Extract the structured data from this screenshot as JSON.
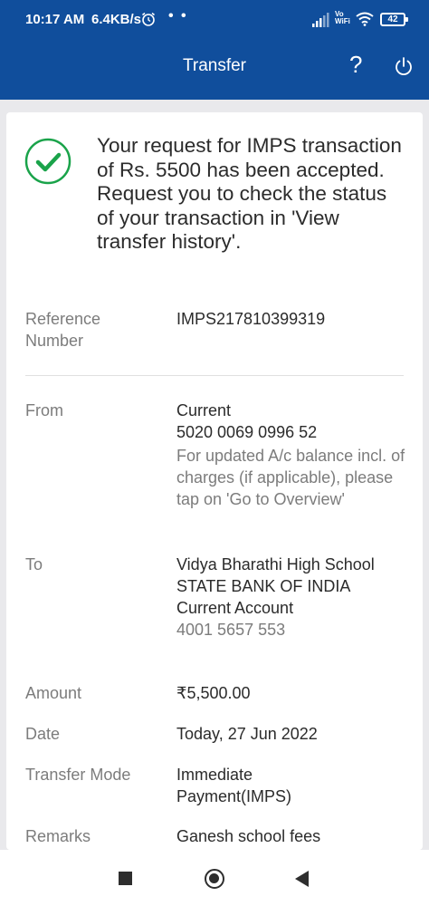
{
  "status_bar": {
    "time": "10:17 AM",
    "speed": "6.4KB/s",
    "dots": "• •",
    "vo_wifi_top": "Vo",
    "vo_wifi_bottom": "WiFi",
    "battery": "42"
  },
  "header": {
    "title": "Transfer",
    "help": "?",
    "color": "#104e9c"
  },
  "confirmation": {
    "message": "Your request for IMPS transaction of Rs. 5500 has been accepted. Request you to check the status of your transaction in 'View transfer history'.",
    "icon": "check-circle-icon",
    "icon_color": "#1aa34a"
  },
  "details": {
    "reference": {
      "label_1": "Reference",
      "label_2": "Number",
      "value": "IMPS217810399319"
    },
    "from": {
      "label": "From",
      "account_type": "Current",
      "account_number": "5020 0069 0996 52",
      "note": "For updated A/c balance incl. of charges (if applicable), please tap on 'Go to Overview'"
    },
    "to": {
      "label": "To",
      "name": "Vidya Bharathi High School",
      "bank": "STATE BANK OF INDIA",
      "account_type": "Current Account",
      "account_number": "4001 5657 553"
    },
    "amount": {
      "label": "Amount",
      "value": "₹5,500.00"
    },
    "date": {
      "label": "Date",
      "value": "Today, 27 Jun 2022"
    },
    "transfer_mode": {
      "label": "Transfer Mode",
      "value": "Immediate Payment(IMPS)"
    },
    "remarks": {
      "label": "Remarks",
      "value": "Ganesh school fees"
    }
  },
  "nav_bar": {
    "recents": "square-icon",
    "home": "circle-icon",
    "back": "triangle-back-icon"
  }
}
